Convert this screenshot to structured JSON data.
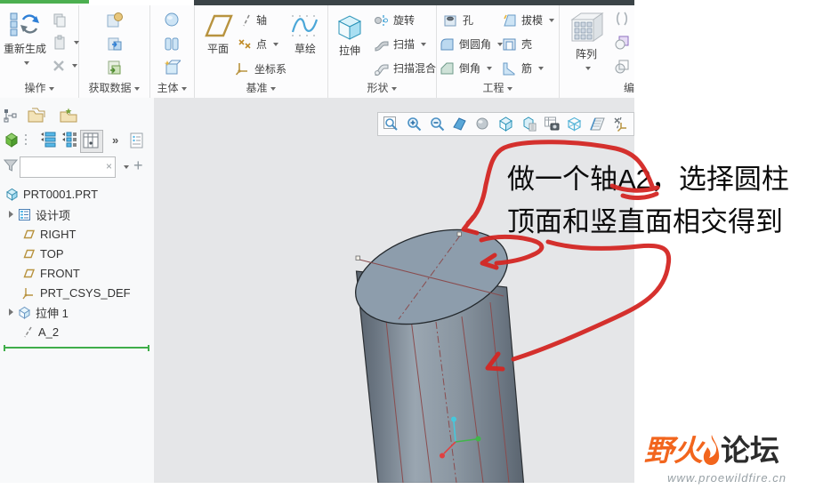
{
  "ribbon": {
    "groups": [
      {
        "label": "操作"
      },
      {
        "label": "获取数据"
      },
      {
        "label": "主体"
      },
      {
        "label": "基准"
      },
      {
        "label": "形状"
      },
      {
        "label": "工程"
      },
      {
        "label": "编"
      }
    ],
    "buttons": {
      "regenerate": "重新生成",
      "plane": "平面",
      "axis": "轴",
      "point": "点",
      "csys": "坐标系",
      "sketch": "草绘",
      "extrude": "拉伸",
      "revolve": "旋转",
      "sweep": "扫描",
      "swept_blend": "扫描混合",
      "hole": "孔",
      "round": "倒圆角",
      "chamfer": "倒角",
      "draft": "拔模",
      "shell": "壳",
      "rib": "筋",
      "pattern": "阵列"
    }
  },
  "nav": {
    "filter": {
      "value": "",
      "placeholder": ""
    },
    "tree": [
      {
        "label": "PRT0001.PRT"
      },
      {
        "label": "设计项"
      },
      {
        "label": "RIGHT"
      },
      {
        "label": "TOP"
      },
      {
        "label": "FRONT"
      },
      {
        "label": "PRT_CSYS_DEF"
      },
      {
        "label": "拉伸 1"
      },
      {
        "label": "A_2"
      }
    ]
  },
  "annotation": {
    "line1": "做一个轴A2，选择圆柱",
    "line2": "顶面和竖直面相交得到"
  },
  "watermark": {
    "brand_left": "野火",
    "brand_right": "论坛",
    "url": "www.proewildfire.cn"
  },
  "colors": {
    "annotation_red": "#d42723",
    "insert_green": "#3fae49",
    "watermark_orange": "#f2651d",
    "edge_maroon": "#8a4c4e"
  }
}
